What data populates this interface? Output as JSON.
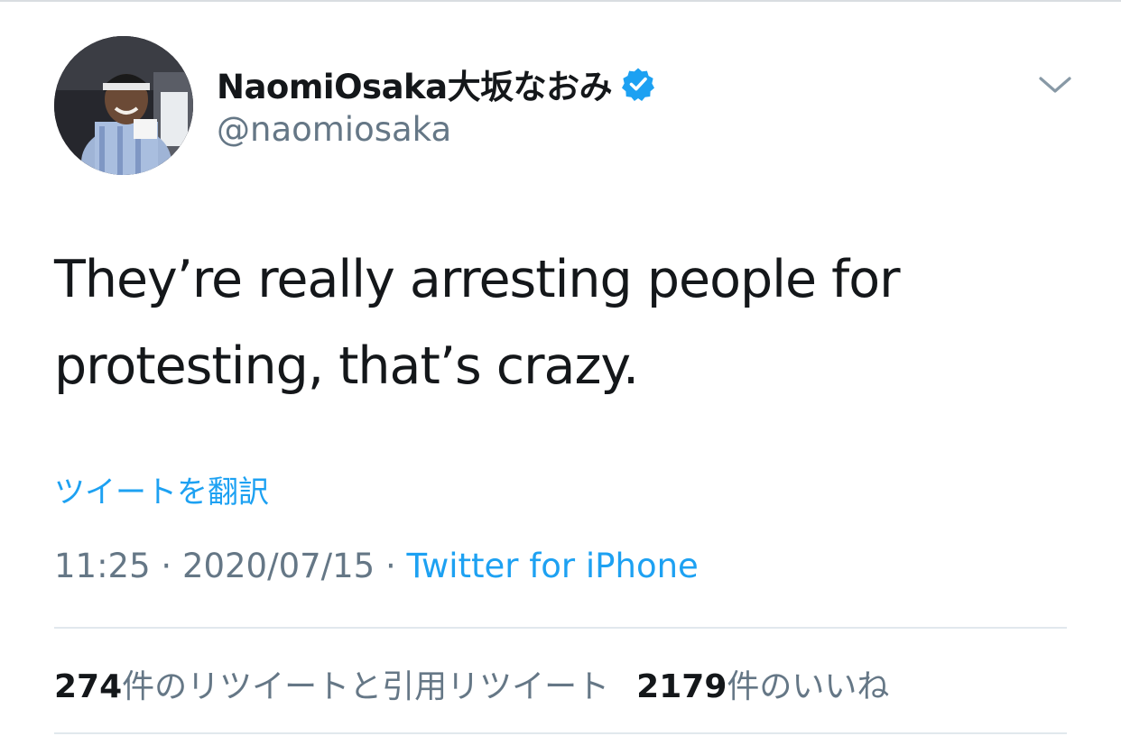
{
  "tweet": {
    "author": {
      "display_name": "NaomiOsaka大坂なおみ",
      "handle": "@naomiosaka",
      "verified": true,
      "avatar_icon": "profile-photo"
    },
    "text_line_1": "They’re really arresting people for",
    "text_line_2": "protesting, that’s crazy.",
    "translate_label": "ツイートを翻訳",
    "time": "11:25",
    "separator": " · ",
    "date": "2020/07/15",
    "source": "Twitter for iPhone",
    "stats": {
      "retweet_count": "274",
      "retweet_label": "件のリツイートと引用リツイート",
      "like_count": "2179",
      "like_label": "件のいいね"
    }
  },
  "icons": {
    "verified": "verified-badge-icon",
    "menu": "chevron-down-icon"
  },
  "colors": {
    "text_primary": "#14171a",
    "text_secondary": "#657786",
    "link_blue": "#1da1f2",
    "verified_blue": "#1da1f2",
    "divider": "#e1e8ed"
  }
}
